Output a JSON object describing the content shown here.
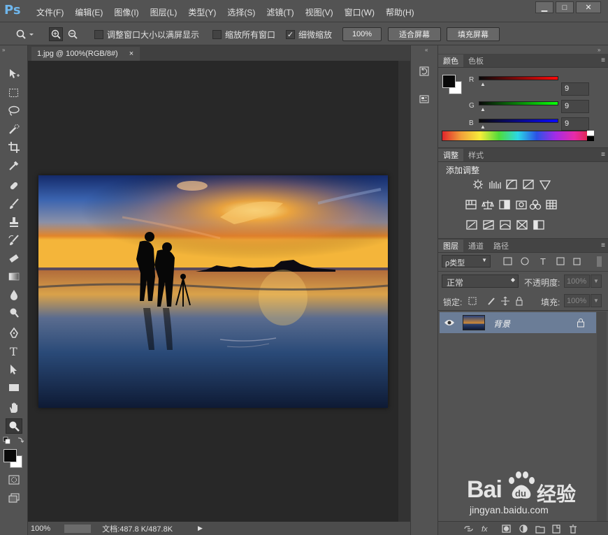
{
  "app": {
    "logo": "Ps"
  },
  "menubar": {
    "items": [
      "文件(F)",
      "编辑(E)",
      "图像(I)",
      "图层(L)",
      "类型(Y)",
      "选择(S)",
      "滤镜(T)",
      "视图(V)",
      "窗口(W)",
      "帮助(H)"
    ]
  },
  "window_controls": {
    "minimize": "▁",
    "maximize": "□",
    "close": "✕"
  },
  "options": {
    "resize_windows_label": "调整窗口大小以满屏显示",
    "zoom_all_label": "缩放所有窗口",
    "scrubby_zoom_label": "细微缩放",
    "scrubby_checked": "✓",
    "btn_100": "100%",
    "btn_fit": "适合屏幕",
    "btn_fill": "填充屏幕"
  },
  "document": {
    "tab_title": "1.jpg @ 100%(RGB/8#)",
    "tab_close": "×"
  },
  "status": {
    "zoom": "100%",
    "doc_size": "文档:487.8 K/487.8K"
  },
  "color_panel": {
    "tabs": [
      "颜色",
      "色板"
    ],
    "r_label": "R",
    "g_label": "G",
    "b_label": "B",
    "r_value": "9",
    "g_value": "9",
    "b_value": "9"
  },
  "adjust_panel": {
    "tabs": [
      "调整",
      "样式"
    ],
    "heading": "添加调整"
  },
  "layers_panel": {
    "tabs": [
      "图层",
      "通道",
      "路径"
    ],
    "filter_label": "ρ类型",
    "blend_mode": "正常",
    "opacity_label": "不透明度:",
    "opacity_value": "100%",
    "lock_label": "锁定:",
    "fill_label": "填充:",
    "fill_value": "100%",
    "layers": [
      {
        "name": "背景"
      }
    ]
  },
  "watermark": {
    "brand": "Bai",
    "brand2": "经验",
    "url": "jingyan.baidu.com"
  },
  "colors": {
    "accent_layer": "#6b7d97",
    "ps_blue": "#6fb6ec"
  }
}
